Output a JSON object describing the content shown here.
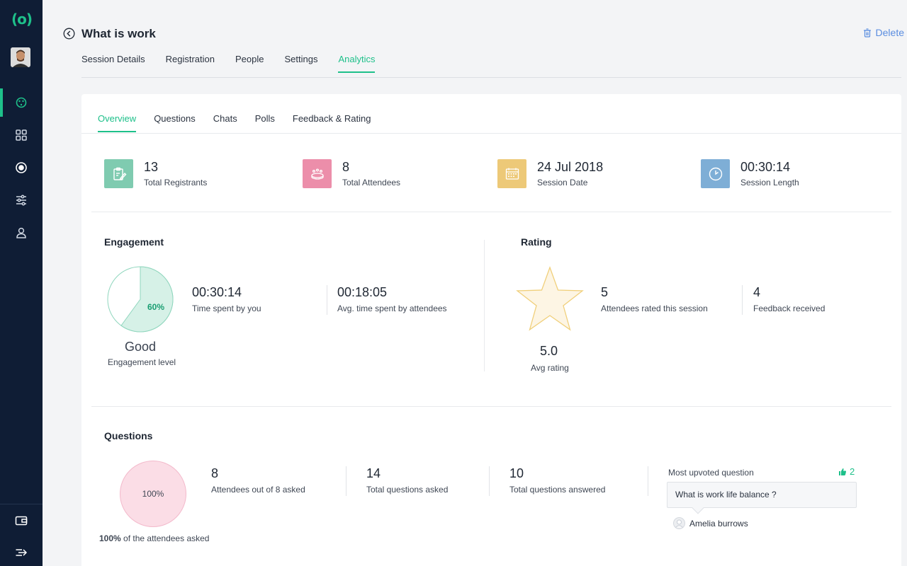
{
  "sidebar": {
    "logo": "(o)",
    "nav": [
      {
        "name": "palette-icon",
        "active": true
      },
      {
        "name": "grid-icon",
        "active": false
      },
      {
        "name": "record-icon",
        "active": false
      },
      {
        "name": "sliders-icon",
        "active": false
      },
      {
        "name": "user-icon",
        "active": false
      }
    ],
    "bottom": [
      "wallet-icon",
      "collapse-arrow-icon"
    ]
  },
  "header": {
    "title": "What is work",
    "delete_label": "Delete",
    "tabs": [
      {
        "label": "Session Details",
        "active": false
      },
      {
        "label": "Registration",
        "active": false
      },
      {
        "label": "People",
        "active": false
      },
      {
        "label": "Settings",
        "active": false
      },
      {
        "label": "Analytics",
        "active": true
      }
    ]
  },
  "subtabs": [
    {
      "label": "Overview",
      "active": true
    },
    {
      "label": "Questions",
      "active": false
    },
    {
      "label": "Chats",
      "active": false
    },
    {
      "label": "Polls",
      "active": false
    },
    {
      "label": "Feedback & Rating",
      "active": false
    }
  ],
  "stats": [
    {
      "value": "13",
      "label": "Total Registrants",
      "color": "#7fcbb0",
      "icon": "clipboard-edit-icon"
    },
    {
      "value": "8",
      "label": "Total Attendees",
      "color": "#ec8eaa",
      "icon": "attendees-table-icon"
    },
    {
      "value": "24 Jul 2018",
      "label": "Session Date",
      "color": "#edc978",
      "icon": "calendar-icon"
    },
    {
      "value": "00:30:14",
      "label": "Session Length",
      "color": "#7eaed6",
      "icon": "clock-icon"
    }
  ],
  "engagement": {
    "title": "Engagement",
    "percent_label": "60%",
    "percent": 60,
    "level": "Good",
    "level_label": "Engagement level",
    "metrics": [
      {
        "value": "00:30:14",
        "label": "Time spent by you"
      },
      {
        "value": "00:18:05",
        "label": "Avg. time spent by attendees"
      }
    ]
  },
  "rating": {
    "title": "Rating",
    "avg_value": "5.0",
    "avg_label": "Avg rating",
    "metrics": [
      {
        "value": "5",
        "label": "Attendees rated this session"
      },
      {
        "value": "4",
        "label": "Feedback received"
      }
    ]
  },
  "questions": {
    "title": "Questions",
    "circle_label": "100%",
    "asked_bold": "100%",
    "asked_text": " of the attendees asked",
    "metrics": [
      {
        "value": "8",
        "label": "Attendees out of 8 asked"
      },
      {
        "value": "14",
        "label": "Total questions asked"
      },
      {
        "value": "10",
        "label": "Total questions answered"
      }
    ],
    "most_upvoted": {
      "heading": "Most upvoted question",
      "votes": "2",
      "question": "What is work life balance ?",
      "author": "Amelia burrows"
    }
  },
  "colors": {
    "accent": "#1ec08a",
    "sidebar": "#0f1d35",
    "link": "#5a8de0"
  }
}
